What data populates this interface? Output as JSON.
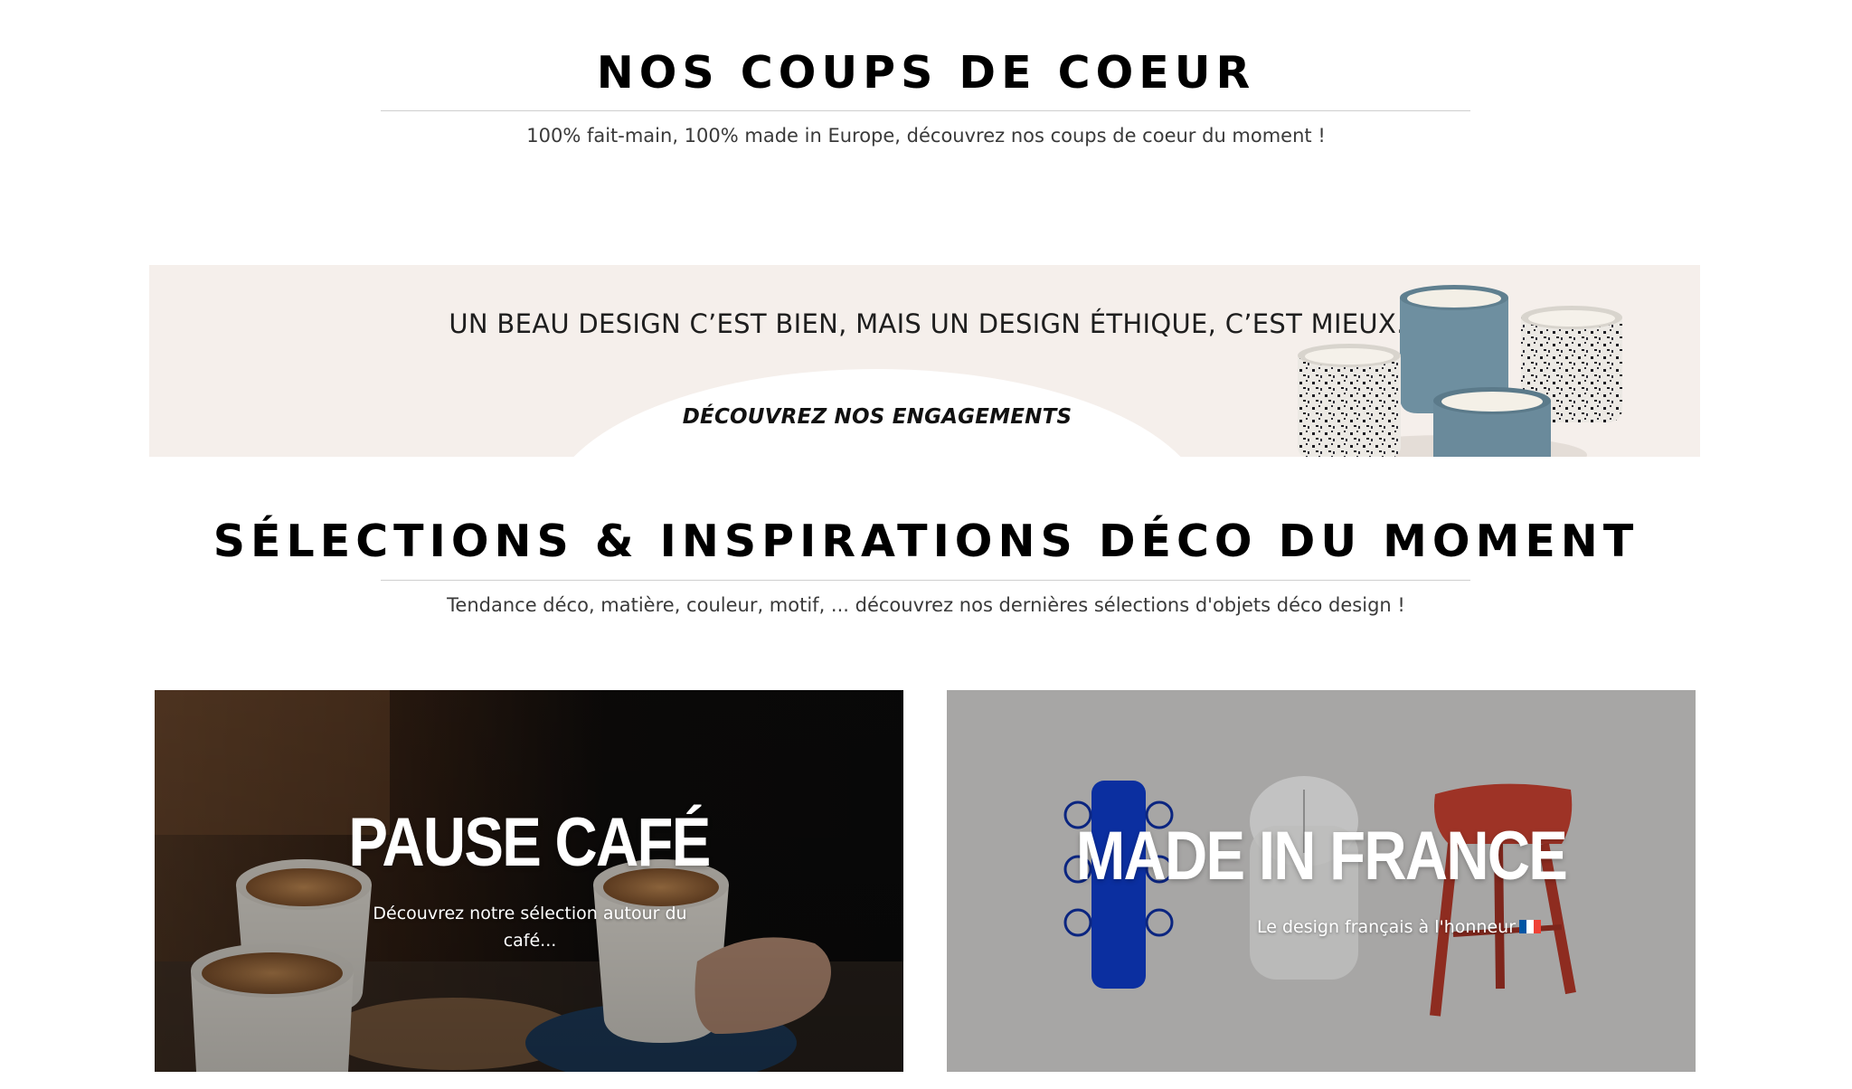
{
  "coups_de_coeur": {
    "title": "NOS COUPS DE COEUR",
    "subtitle": "100% fait-main, 100% made in Europe, découvrez nos coups de coeur du moment !"
  },
  "banner": {
    "headline": "UN BEAU DESIGN C’EST BIEN, MAIS UN DESIGN ÉTHIQUE, C’EST MIEUX.",
    "cta": "DÉCOUVREZ NOS ENGAGEMENTS"
  },
  "selections": {
    "title": "SÉLECTIONS & INSPIRATIONS DÉCO DU MOMENT",
    "subtitle": "Tendance déco, matière, couleur, motif, ... découvrez nos dernières sélections d'objets déco design !"
  },
  "cards": [
    {
      "title": "PAUSE CAFÉ",
      "subtitle": "Découvrez notre sélection autour du café..."
    },
    {
      "title": "MADE IN FRANCE",
      "subtitle": "Le design français à l'honneur",
      "icon": "french-flag-icon"
    }
  ],
  "colors": {
    "banner_bg": "#f5efeb",
    "card_cafe_bg": "#1a1410",
    "card_france_bg": "#a7a6a5",
    "flag_blue": "#0055a4",
    "flag_white": "#ffffff",
    "flag_red": "#ef4135"
  }
}
